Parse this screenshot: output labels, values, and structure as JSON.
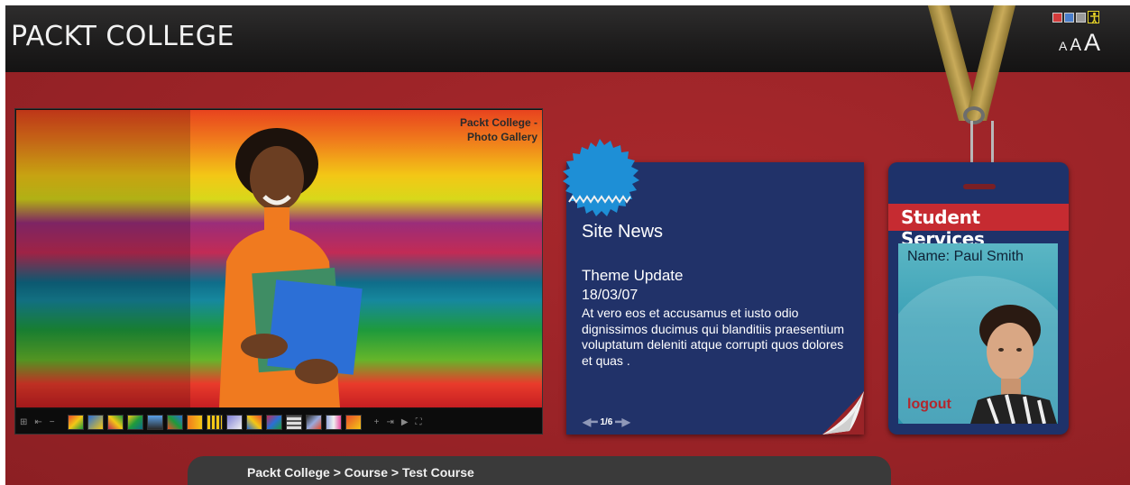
{
  "header": {
    "site_title": "PACKT COLLEGE",
    "text_size_small": "A",
    "text_size_medium": "A",
    "text_size_large": "A",
    "color_swatches": [
      "#d33b3b",
      "#4a7ecb",
      "#9a9a9a"
    ],
    "accessibility_icon": "accessibility-person-icon"
  },
  "gallery": {
    "caption_line1": "Packt College -",
    "caption_line2": "Photo Gallery",
    "thumbnail_count": 16
  },
  "news": {
    "title": "Site News",
    "headline": "Theme Update",
    "date": "18/03/07",
    "body": "At vero eos et accusamus et iusto odio dignissimos ducimus qui blanditiis praesentium voluptatum deleniti atque corrupti quos dolores et quas .",
    "pager": "1/6"
  },
  "student_services": {
    "title": "Student Services",
    "name": "Name: Paul Smith",
    "logout": "logout"
  },
  "breadcrumb": {
    "text": "Packt College > Course > Test Course"
  },
  "colors": {
    "page_red": "#9a2327",
    "header_dark": "#1d1c1c",
    "news_navy": "#213269",
    "id_red": "#c62b31"
  }
}
